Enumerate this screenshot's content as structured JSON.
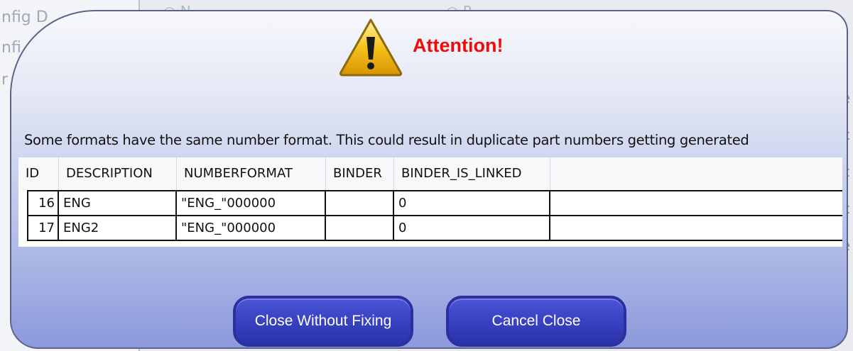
{
  "background": {
    "left_fragments": [
      "nfig D",
      "nfi",
      "r"
    ],
    "top_fragments": [
      "◎ N",
      "◎ R"
    ],
    "right_fragments": [
      "e",
      "k",
      "c",
      "c",
      "e"
    ]
  },
  "dialog": {
    "title": "Attention!",
    "icon": "warning-icon",
    "message": "Some formats have the same number format.  This could result in duplicate part numbers getting generated",
    "table": {
      "columns": [
        "ID",
        "DESCRIPTION",
        "NUMBERFORMAT",
        "BINDER",
        "BINDER_IS_LINKED"
      ],
      "rows": [
        [
          "16",
          "ENG",
          "\"ENG_\"000000",
          "",
          "0"
        ],
        [
          "17",
          "ENG2",
          "\"ENG_\"000000",
          "",
          "0"
        ]
      ]
    },
    "buttons": {
      "close_without_fixing": "Close Without Fixing",
      "cancel_close": "Cancel Close"
    },
    "colors": {
      "title": "#f10a0a",
      "button": "#3a43c4",
      "border": "#5c6488"
    }
  }
}
